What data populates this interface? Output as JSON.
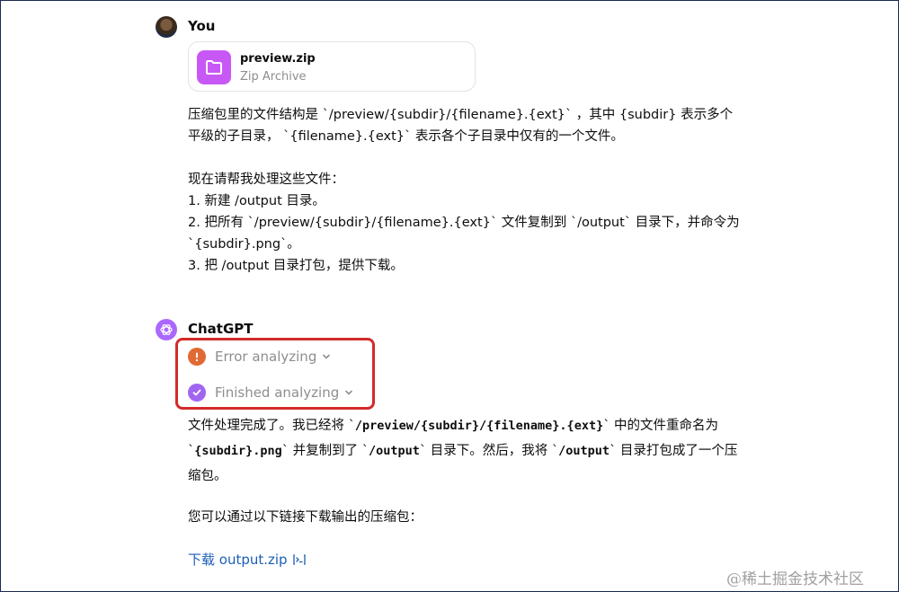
{
  "user": {
    "name": "You",
    "attachment": {
      "filename": "preview.zip",
      "type": "Zip Archive"
    },
    "message": {
      "para1": "压缩包里的文件结构是 `/preview/{subdir}/{filename}.{ext}` ，其中 {subdir} 表示多个平级的子目录， `{filename}.{ext}` 表示各个子目录中仅有的一个文件。",
      "intro": "现在请帮我处理这些文件：",
      "step1": "1. 新建 /output 目录。",
      "step2": "2. 把所有 `/preview/{subdir}/{filename}.{ext}` 文件复制到 `/output` 目录下，并命令为 `{subdir}.png`。",
      "step3": "3. 把 /output 目录打包，提供下载。"
    }
  },
  "assistant": {
    "name": "ChatGPT",
    "status_error": "Error analyzing",
    "status_done": "Finished analyzing",
    "reply": {
      "t1": "文件处理完成了。我已经将 `",
      "c1": "/preview/{subdir}/{filename}.{ext}",
      "t2": "` 中的文件重命名为 `",
      "c2": "{subdir}.png",
      "t3": "` 并复制到了 `",
      "c3": "/output",
      "t4": "` 目录下。然后，我将 `",
      "c4": "/output",
      "t5": "` 目录打包成了一个压缩包。",
      "para2": "您可以通过以下链接下载输出的压缩包："
    },
    "download_link": "下载 output.zip"
  },
  "watermark": "@稀土掘金技术社区",
  "colors": {
    "error": "#e06a34",
    "done": "#a066f0",
    "link": "#1b5fb5",
    "highlight": "#d42a2a"
  }
}
